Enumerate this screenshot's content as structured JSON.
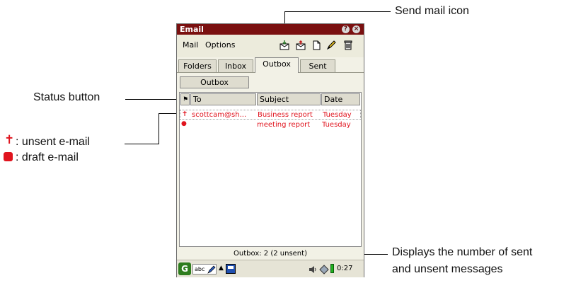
{
  "annotations": {
    "send_mail_icon": "Send mail icon",
    "status_button": "Status button",
    "unsent_label": ": unsent e-mail",
    "draft_label": ": draft e-mail",
    "displays_line1": "Displays the number of sent",
    "displays_line2": "and unsent messages"
  },
  "window": {
    "title": "Email",
    "help_glyph": "?",
    "close_glyph": "×"
  },
  "menu": {
    "items": [
      "Mail",
      "Options"
    ]
  },
  "toolbar": {
    "icons": [
      "receive-mail-icon",
      "send-mail-icon",
      "new-mail-icon",
      "edit-icon",
      "trash-icon"
    ]
  },
  "tabs": [
    {
      "label": "Folders",
      "active": false
    },
    {
      "label": "Inbox",
      "active": false
    },
    {
      "label": "Outbox",
      "active": true
    },
    {
      "label": "Sent",
      "active": false
    }
  ],
  "folder_button": "Outbox",
  "columns": {
    "status": "⚑",
    "to": "To",
    "subject": "Subject",
    "date": "Date"
  },
  "messages": [
    {
      "status": "unsent",
      "status_glyph": "✝",
      "to": "scottcam@sh...",
      "subject": "Business report",
      "date": "Tuesday"
    },
    {
      "status": "draft",
      "status_glyph": "●",
      "to": "",
      "subject": "meeting report",
      "date": "Tuesday"
    }
  ],
  "status_text": "Outbox: 2 (2 unsent)",
  "taskbar": {
    "input_label": "abc",
    "time": "0:27"
  },
  "colors": {
    "titlebar": "#7a1010",
    "message_text": "#e0141e"
  }
}
